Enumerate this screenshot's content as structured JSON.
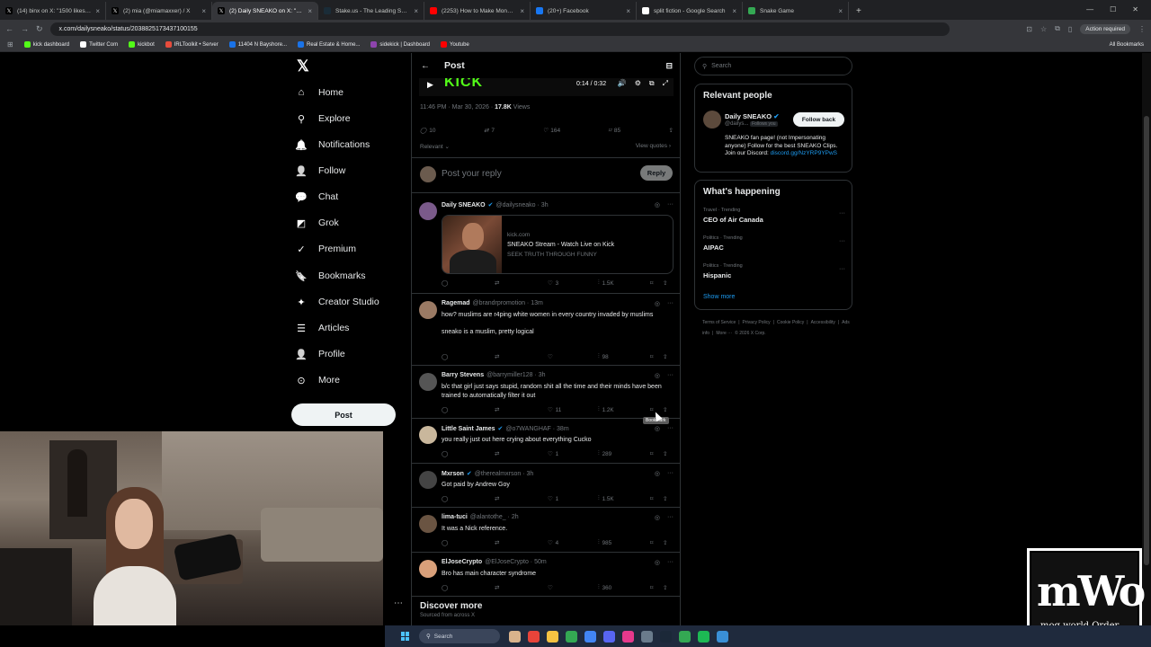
{
  "browser": {
    "tabs": [
      {
        "label": "(14) binx on X: \"1500 likes on a",
        "favicon": "x",
        "active": false
      },
      {
        "label": "(2) mia (@miamaxxer) / X",
        "favicon": "x",
        "active": false
      },
      {
        "label": "(2) Daily SNEAKO on X: \"SNEAK",
        "favicon": "x",
        "active": true
      },
      {
        "label": "Stake.us - The Leading Social C",
        "favicon": "stake",
        "active": false
      },
      {
        "label": "(2253) How to Make Money on",
        "favicon": "youtube",
        "active": false
      },
      {
        "label": "(20+) Facebook",
        "favicon": "facebook",
        "active": false
      },
      {
        "label": "split fiction - Google Search",
        "favicon": "google",
        "active": false
      },
      {
        "label": "Snake Game",
        "favicon": "snake",
        "active": false
      }
    ],
    "url": "x.com/dailysneako/status/2038825173437100155",
    "action_required": "Action required",
    "bookmarks": [
      {
        "label": "kick dashboard",
        "color": "#53fc18"
      },
      {
        "label": "Twitter Com",
        "color": "#ffffff"
      },
      {
        "label": "kickbot",
        "color": "#53fc18"
      },
      {
        "label": "IRLToolkit • Server",
        "color": "#e74c3c"
      },
      {
        "label": "11404 N Bayshore...",
        "color": "#1a73e8"
      },
      {
        "label": "Real Estate & Home...",
        "color": "#1a73e8"
      },
      {
        "label": "sidekick | Dashboard",
        "color": "#8e44ad"
      },
      {
        "label": "Youtube",
        "color": "#ff0000"
      }
    ],
    "all_bookmarks": "All Bookmarks"
  },
  "sidebar": {
    "items": [
      {
        "label": "Home",
        "icon": "home-icon",
        "glyph": "⌂"
      },
      {
        "label": "Explore",
        "icon": "search-icon",
        "glyph": "⚲"
      },
      {
        "label": "Notifications",
        "icon": "bell-icon",
        "glyph": "🔔"
      },
      {
        "label": "Follow",
        "icon": "follow-icon",
        "glyph": "👤"
      },
      {
        "label": "Chat",
        "icon": "chat-icon",
        "glyph": "💬"
      },
      {
        "label": "Grok",
        "icon": "grok-icon",
        "glyph": "◩"
      },
      {
        "label": "Premium",
        "icon": "premium-icon",
        "glyph": "✓"
      },
      {
        "label": "Bookmarks",
        "icon": "bookmark-icon",
        "glyph": "🔖"
      },
      {
        "label": "Creator Studio",
        "icon": "creator-studio-icon",
        "glyph": "✦"
      },
      {
        "label": "Articles",
        "icon": "articles-icon",
        "glyph": "☰"
      },
      {
        "label": "Profile",
        "icon": "profile-icon",
        "glyph": "👤"
      },
      {
        "label": "More",
        "icon": "more-icon",
        "glyph": "⊙"
      }
    ],
    "post_button": "Post"
  },
  "post": {
    "header": "Post",
    "video_time": "0:14 / 0:32",
    "timestamp": "11:46 PM · Mar 30, 2026 ·",
    "views_count": "17.8K",
    "views_label": "Views",
    "stats": {
      "replies": "10",
      "reposts": "7",
      "likes": "164",
      "bookmarks": "85"
    },
    "sort_label": "Relevant",
    "view_quotes": "View quotes",
    "reply_placeholder": "Post your reply",
    "reply_button": "Reply"
  },
  "replies": [
    {
      "name": "Daily SNEAKO",
      "verified": true,
      "handle": "@dailysneako · 3h",
      "text": "",
      "likes": "3",
      "views": "1.5K",
      "card": {
        "domain": "kick.com",
        "title": "SNEAKO Stream - Watch Live on Kick",
        "desc": "SEEK TRUTH THROUGH FUNNY"
      }
    },
    {
      "name": "Ragemad",
      "verified": false,
      "handle": "@brandrpromotion · 13m",
      "text": "how? muslims are r4ping white women in every country invaded by muslims\n\nsneako is a muslim, pretty logical",
      "likes": "",
      "views": "98"
    },
    {
      "name": "Barry Stevens",
      "verified": false,
      "handle": "@barrymiller128 · 3h",
      "text": "b/c that girl just says stupid, random shit all the time and their minds have been trained to automatically filter it out",
      "likes": "11",
      "views": "1.2K"
    },
    {
      "name": "Little Saint James",
      "verified": true,
      "handle": "@o7WANGHAF · 38m",
      "text": "you really just out here crying about everything Cucko",
      "likes": "1",
      "views": "289"
    },
    {
      "name": "Mxrson",
      "verified": true,
      "handle": "@therealmxrson · 3h",
      "text": "Got paid by Andrew Goy",
      "likes": "1",
      "views": "1.5K"
    },
    {
      "name": "lima-tuci",
      "verified": false,
      "handle": "@alantothe_ · 2h",
      "text": "It was a Nick reference.",
      "likes": "4",
      "views": "985"
    },
    {
      "name": "ElJoseCrypto",
      "verified": false,
      "handle": "@ElJoseCrypto · 50m",
      "text": "Bro has main character syndrome",
      "likes": "",
      "views": "360"
    }
  ],
  "tooltip": "Bookmark",
  "discover": {
    "title": "Discover more",
    "sub": "Sourced from across X"
  },
  "right": {
    "search_placeholder": "Search",
    "relevant_title": "Relevant people",
    "person": {
      "name": "Daily SNEAKO",
      "handle": "@dailys...",
      "follows_you": "Follows you",
      "follow_button": "Follow back",
      "bio": "SNEAKO fan page! (not Impersonating anyone) Follow for the best SNEAKO Clips. Join our Discord:",
      "link": "discord.gg/NzYRP9YPwS"
    },
    "happening_title": "What's happening",
    "trends": [
      {
        "category": "Travel · Trending",
        "title": "CEO of Air Canada"
      },
      {
        "category": "Politics · Trending",
        "title": "AIPAC"
      },
      {
        "category": "Politics · Trending",
        "title": "Hispanic"
      }
    ],
    "show_more": "Show more",
    "footer": [
      "Terms of Service",
      "|",
      "Privacy Policy",
      "|",
      "Cookie Policy",
      "|",
      "Accessibility",
      "|",
      "Ads info",
      "|",
      "More ···",
      "© 2026 X Corp."
    ]
  },
  "overlay_logo": {
    "main": "mWo",
    "sub": "mog world Order"
  },
  "taskbar": {
    "search": "Search"
  }
}
